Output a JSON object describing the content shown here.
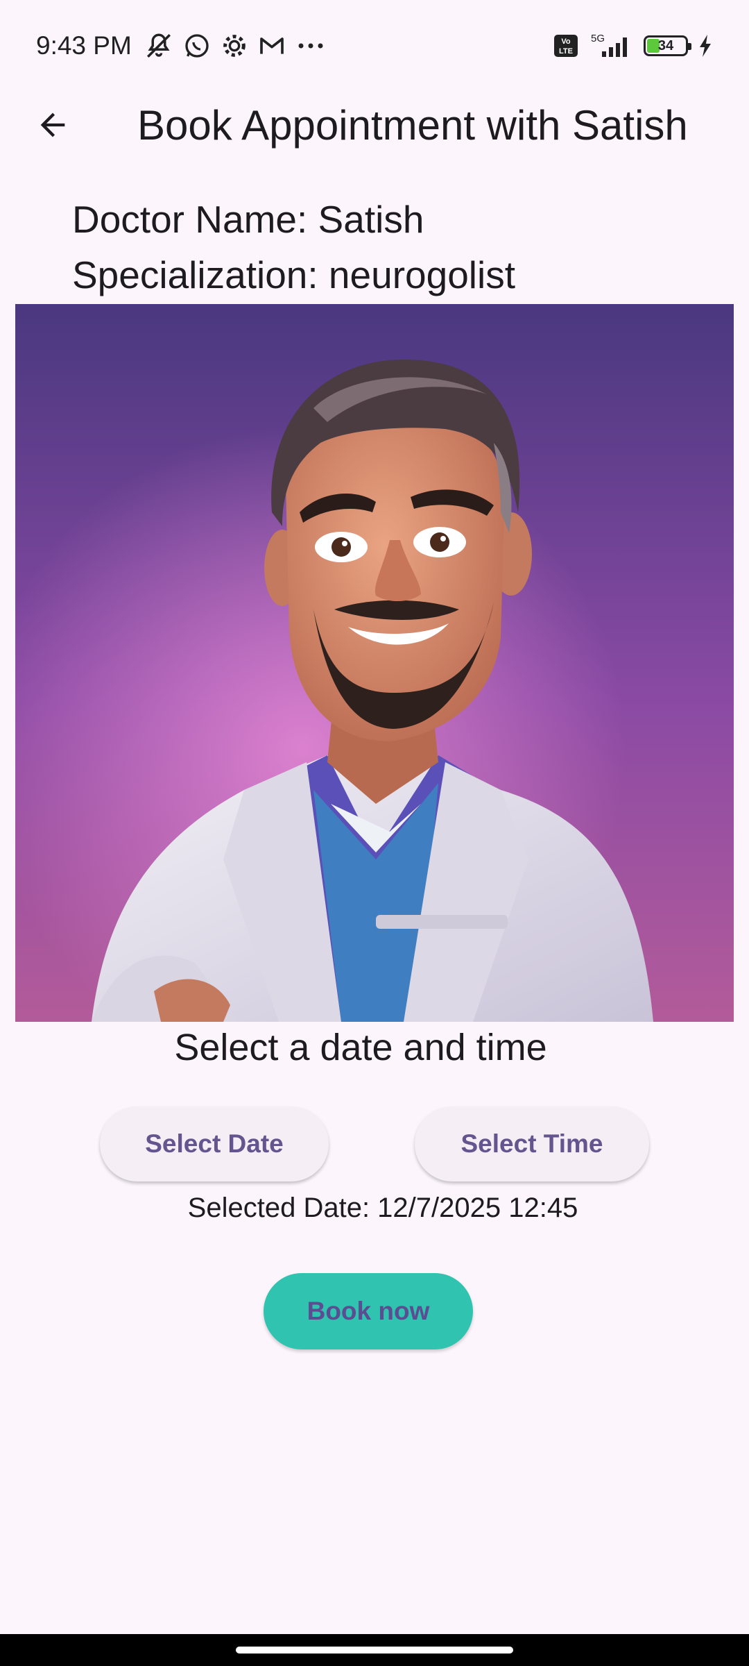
{
  "status_bar": {
    "time": "9:43 PM",
    "left_icons": [
      "mute-icon",
      "whatsapp-icon",
      "settings-icon",
      "gmail-icon",
      "more-icon"
    ],
    "volte": "Vo LTE",
    "network": "5G",
    "battery": "34",
    "battery_level": 0.34,
    "battery_color": "#5cc93b"
  },
  "app_bar": {
    "title": "Book Appointment with Satish"
  },
  "doctor": {
    "name_line": "Doctor Name: Satish",
    "specialization_line": "Specialization: neurogolist"
  },
  "booking": {
    "section_title": "Select a date and time",
    "select_date_label": "Select Date",
    "select_time_label": "Select Time",
    "selected_text": "Selected Date: 12/7/2025 12:45",
    "book_label": "Book now"
  },
  "colors": {
    "background": "#fcf6fc",
    "accent_text": "#65558f",
    "book_button": "#30c4b0"
  }
}
